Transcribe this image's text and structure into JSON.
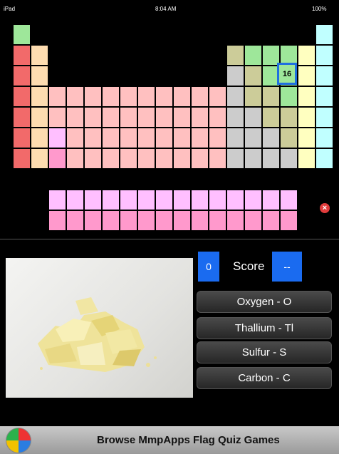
{
  "status_bar": {
    "device": "iPad",
    "time": "8:04 AM",
    "battery": "100%"
  },
  "periodic_table": {
    "highlighted_element": "16",
    "colors": {
      "hydrogen": "#9ee79a",
      "alkali": "#f26a6a",
      "alkaline_earth": "#fddcb0",
      "transition": "#ffc0c0",
      "post_transition": "#cccccc",
      "metalloid": "#cccc99",
      "nonmetal": "#9ee79a",
      "halogen": "#ffffc0",
      "noble_gas": "#c0ffff",
      "lanthanide": "#ffbfff",
      "actinide": "#ff99cc",
      "highlight_border": "#1f6fe0"
    }
  },
  "close_icon": "close-icon",
  "quiz": {
    "correct_count": "0",
    "score_label": "Score",
    "score_value": "--",
    "answers": [
      "Oxygen - O",
      "Thallium - Tl",
      "Sulfur - S",
      "Carbon - C"
    ]
  },
  "banner": {
    "text": "Browse MmpApps Flag Quiz Games"
  }
}
